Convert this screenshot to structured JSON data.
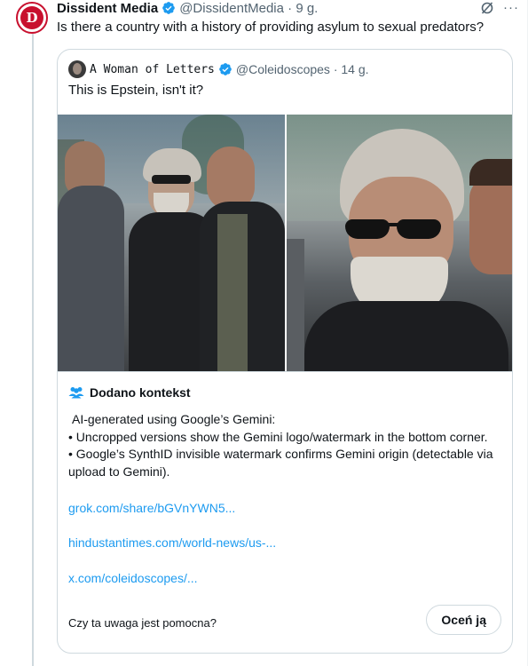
{
  "post": {
    "author_name": "Dissident Media",
    "handle": "@DissidentMedia",
    "time": "9 g.",
    "text": "Is there a country with a history of providing asylum to sexual predators?",
    "avatar_letter": "D",
    "brand_color": "#c8102e"
  },
  "quote": {
    "author_name": "A Woman of Letters",
    "handle": "@Coleidoscopes",
    "time": "14 g.",
    "text": "This is Epstein, isn't it?"
  },
  "note": {
    "title": "Dodano kontekst",
    "line1": "AI-generated using Google’s Gemini:",
    "line2": "• Uncropped versions show the Gemini logo/watermark in the bottom corner.",
    "line3": "• Google’s SynthID invisible watermark confirms Gemini origin (detectable via upload to Gemini).",
    "links": [
      "grok.com/share/bGVnYWN5...",
      "hindustantimes.com/world-news/us-...",
      "x.com/coleidoscopes/..."
    ],
    "question": "Czy ta uwaga jest pomocna?",
    "rate_label": "Oceń ją"
  },
  "icons": {
    "verified": "verified-badge-icon",
    "grok": "grok-icon",
    "more": "more-icon",
    "people": "people-icon"
  },
  "colors": {
    "link": "#1d9bf0",
    "text": "#0f1419",
    "muted": "#536471",
    "border": "#cfd9de"
  }
}
